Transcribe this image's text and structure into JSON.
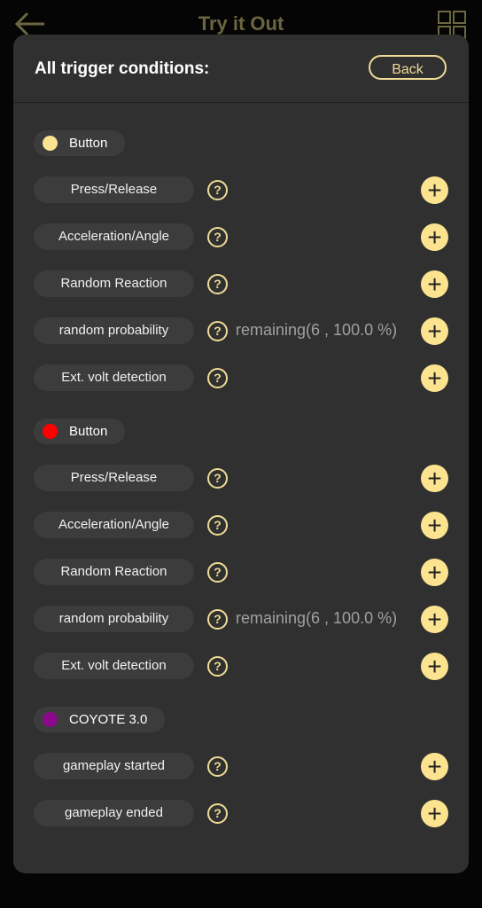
{
  "header": {
    "title": "Try it Out",
    "back_icon": "arrow-left-icon",
    "menu_icon": "grid-icon"
  },
  "dialog": {
    "title": "All trigger conditions:",
    "back_label": "Back",
    "groups": [
      {
        "device_label": "Button",
        "device_color": "#fbe38f",
        "conditions": [
          {
            "label": "Press/Release"
          },
          {
            "label": "Acceleration/Angle"
          },
          {
            "label": "Random Reaction"
          },
          {
            "label": "random probability",
            "note": "remaining(6 , 100.0 %)"
          },
          {
            "label": "Ext. volt detection"
          }
        ]
      },
      {
        "device_label": "Button",
        "device_color": "#ff0000",
        "conditions": [
          {
            "label": "Press/Release"
          },
          {
            "label": "Acceleration/Angle"
          },
          {
            "label": "Random Reaction"
          },
          {
            "label": "random probability",
            "note": "remaining(6 , 100.0 %)"
          },
          {
            "label": "Ext. volt detection"
          }
        ]
      },
      {
        "device_label": "COYOTE 3.0",
        "device_color": "#8b0a8b",
        "conditions": [
          {
            "label": "gameplay started"
          },
          {
            "label": "gameplay ended"
          }
        ]
      }
    ],
    "help_glyph": "?",
    "add_glyph": "+"
  }
}
